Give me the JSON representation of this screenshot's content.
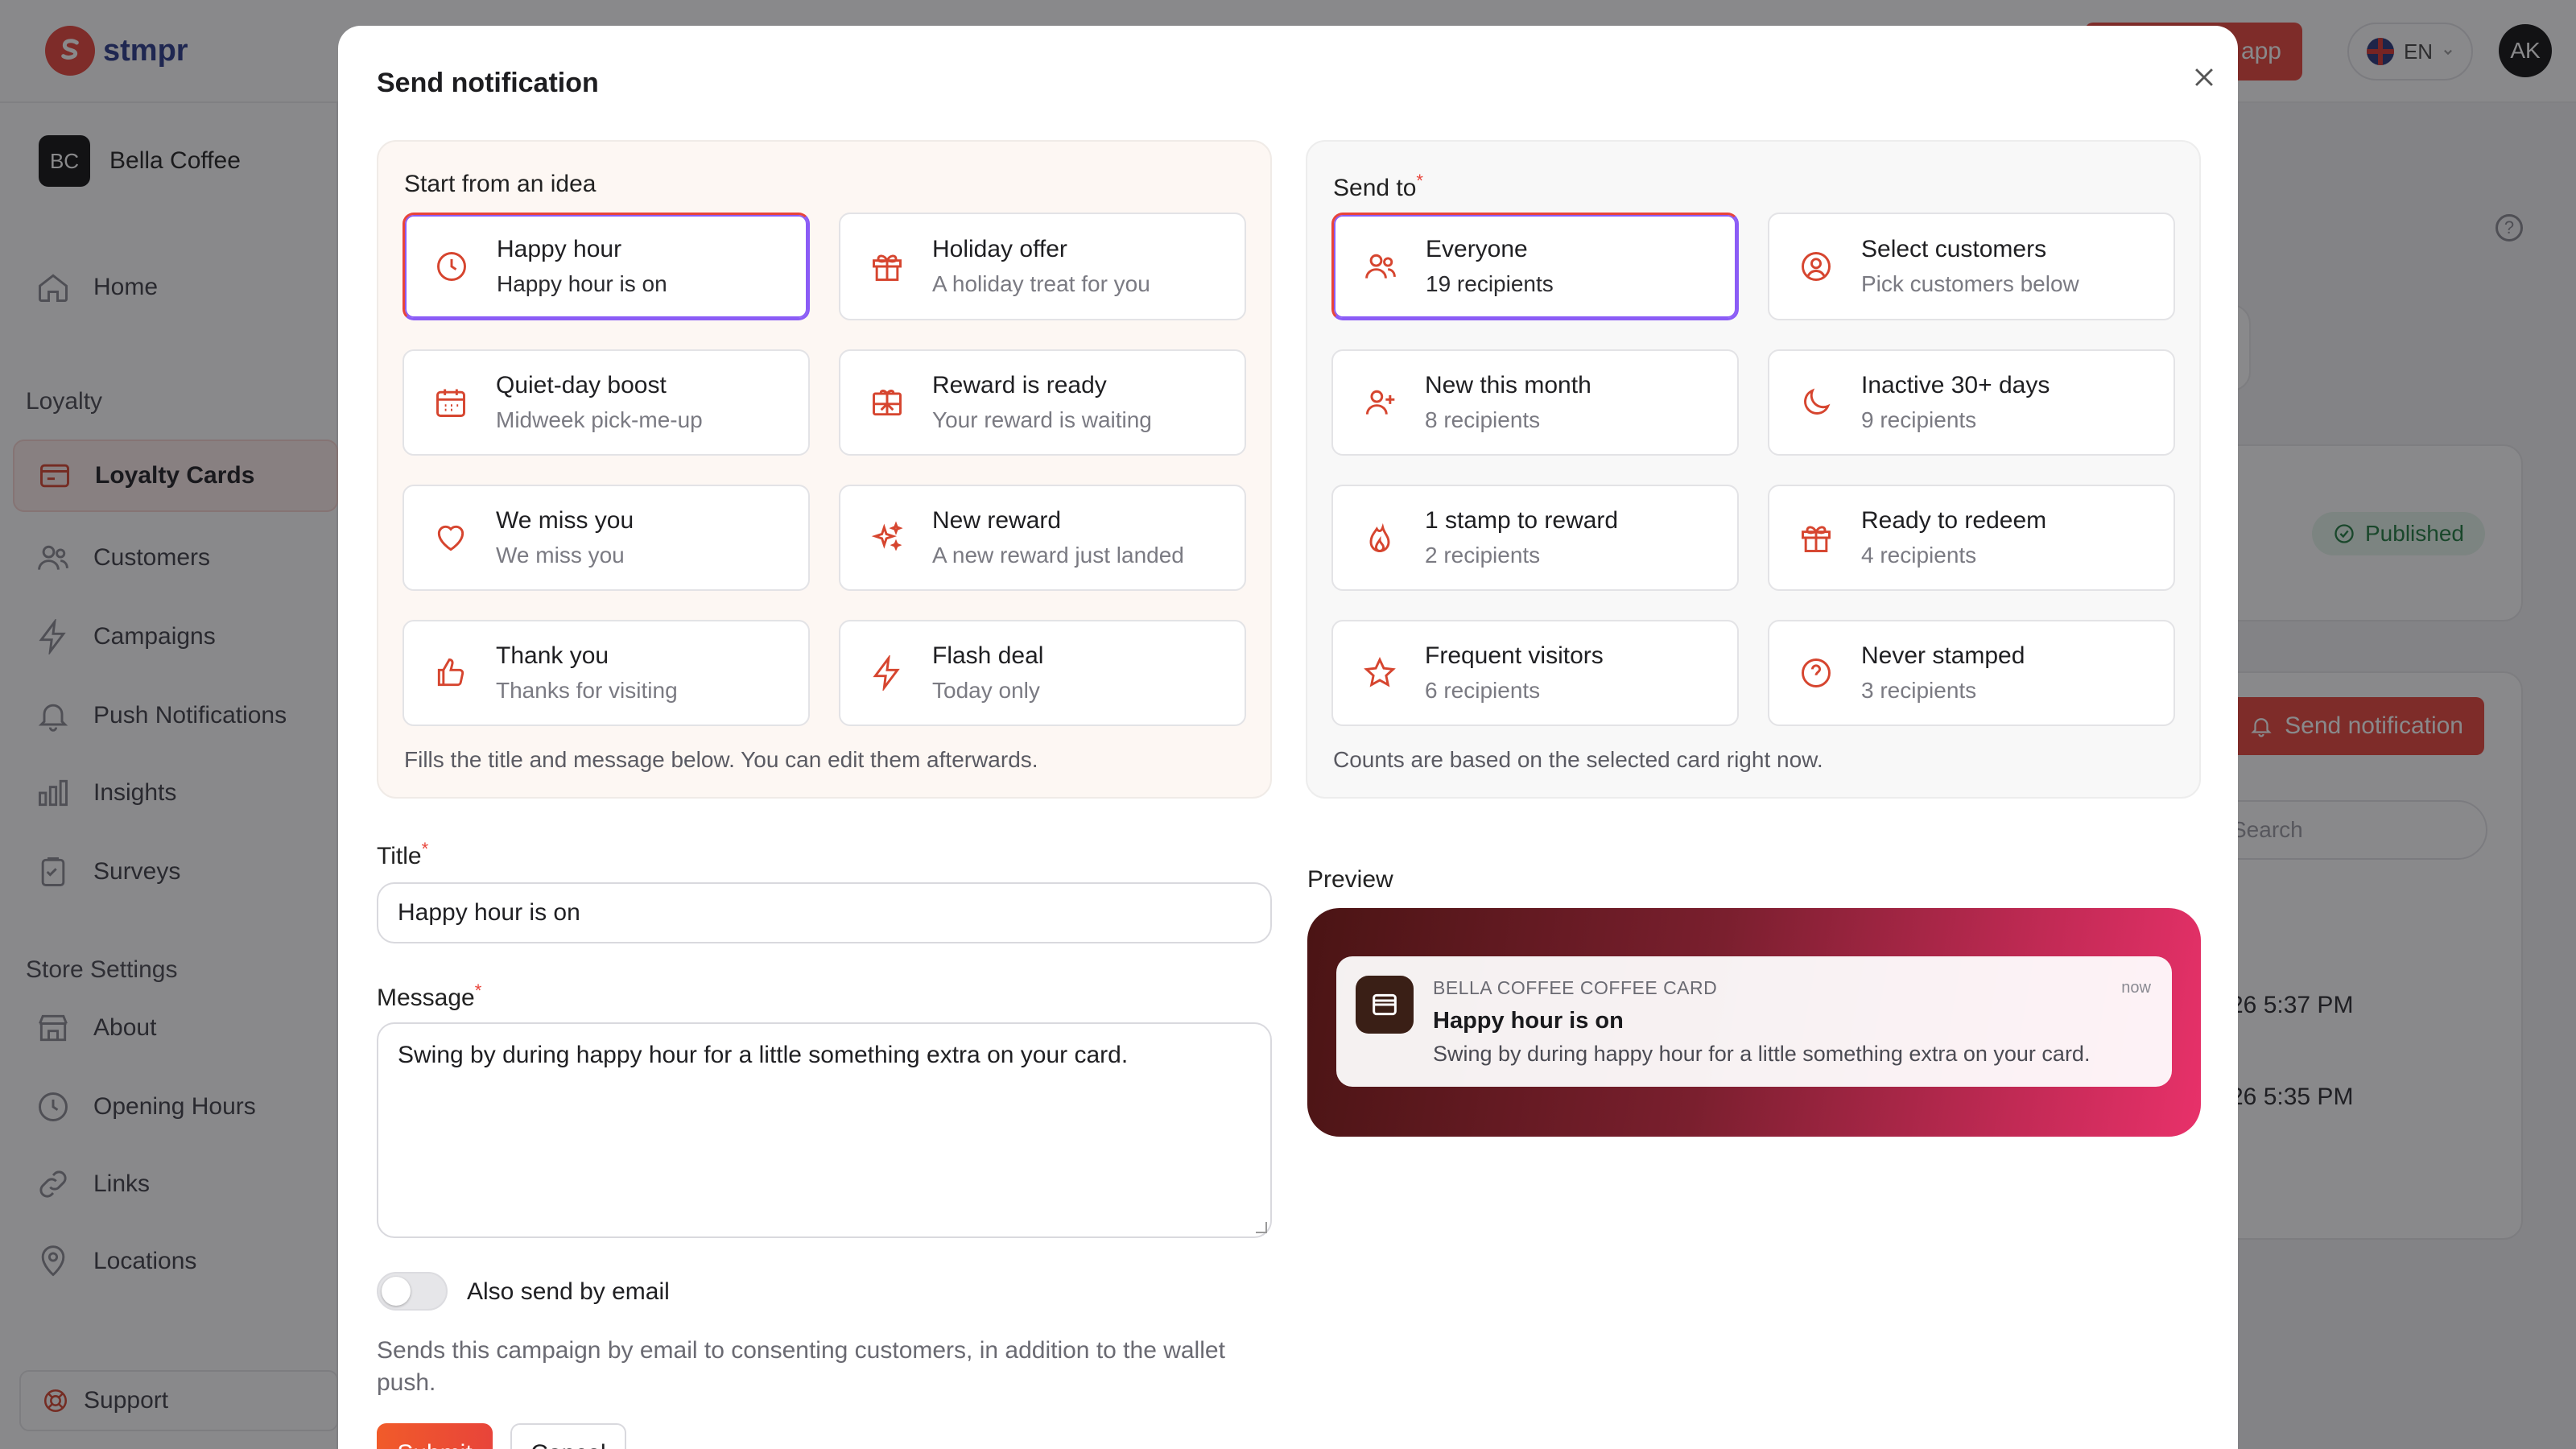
{
  "app": {
    "brand": "stmpr",
    "top_cta_label": "app",
    "language": "EN",
    "user_initials": "AK"
  },
  "sidebar": {
    "business_initials": "BC",
    "business_name": "Bella Coffee",
    "home": "Home",
    "loyalty_heading": "Loyalty",
    "loyalty_items": [
      "Loyalty Cards",
      "Customers",
      "Campaigns",
      "Push Notifications",
      "Insights",
      "Surveys"
    ],
    "store_heading": "Store Settings",
    "store_items": [
      "About",
      "Opening Hours",
      "Links",
      "Locations"
    ],
    "support": "Support"
  },
  "background": {
    "status_badge": "Published",
    "send_button": "Send notification",
    "search_placeholder": "Search",
    "row_times": [
      "26 5:37 PM",
      "26 5:35 PM"
    ]
  },
  "modal": {
    "title": "Send notification",
    "ideas": {
      "label": "Start from an idea",
      "footnote": "Fills the title and message below. You can edit them afterwards.",
      "options": [
        {
          "title": "Happy hour",
          "subtitle": "Happy hour is on",
          "icon": "clock-icon",
          "selected": true
        },
        {
          "title": "Holiday offer",
          "subtitle": "A holiday treat for you",
          "icon": "gift-icon",
          "selected": false
        },
        {
          "title": "Quiet-day boost",
          "subtitle": "Midweek pick-me-up",
          "icon": "calendar-icon",
          "selected": false
        },
        {
          "title": "Reward is ready",
          "subtitle": "Your reward is waiting",
          "icon": "gift-box-icon",
          "selected": false
        },
        {
          "title": "We miss you",
          "subtitle": "We miss you",
          "icon": "heart-icon",
          "selected": false
        },
        {
          "title": "New reward",
          "subtitle": "A new reward just landed",
          "icon": "sparkles-icon",
          "selected": false
        },
        {
          "title": "Thank you",
          "subtitle": "Thanks for visiting",
          "icon": "thumbs-up-icon",
          "selected": false
        },
        {
          "title": "Flash deal",
          "subtitle": "Today only",
          "icon": "lightning-icon",
          "selected": false
        }
      ]
    },
    "audience": {
      "label": "Send to",
      "footnote": "Counts are based on the selected card right now.",
      "options": [
        {
          "title": "Everyone",
          "subtitle": "19 recipients",
          "icon": "users-icon",
          "selected": true
        },
        {
          "title": "Select customers",
          "subtitle": "Pick customers below",
          "icon": "user-circle-icon",
          "selected": false
        },
        {
          "title": "New this month",
          "subtitle": "8 recipients",
          "icon": "user-plus-icon",
          "selected": false
        },
        {
          "title": "Inactive 30+ days",
          "subtitle": "9 recipients",
          "icon": "moon-icon",
          "selected": false
        },
        {
          "title": "1 stamp to reward",
          "subtitle": "2 recipients",
          "icon": "flame-icon",
          "selected": false
        },
        {
          "title": "Ready to redeem",
          "subtitle": "4 recipients",
          "icon": "gift-icon",
          "selected": false
        },
        {
          "title": "Frequent visitors",
          "subtitle": "6 recipients",
          "icon": "star-icon",
          "selected": false
        },
        {
          "title": "Never stamped",
          "subtitle": "3 recipients",
          "icon": "question-circle-icon",
          "selected": false
        }
      ]
    },
    "title_label": "Title",
    "title_value": "Happy hour is on",
    "message_label": "Message",
    "message_value": "Swing by during happy hour for a little something extra on your card.",
    "email_toggle_label": "Also send by email",
    "email_toggle_on": false,
    "email_toggle_help": "Sends this campaign by email to consenting customers, in addition to the wallet push.",
    "submit_label": "Submit",
    "cancel_label": "Cancel",
    "preview": {
      "label": "Preview",
      "app_name": "BELLA COFFEE COFFEE CARD",
      "time": "now",
      "title": "Happy hour is on",
      "body": "Swing by during happy hour for a little something extra on your card."
    }
  },
  "colors": {
    "accent": "#e8443a",
    "selected_outline": "#8b5cf6",
    "icon": "#d6452f"
  }
}
